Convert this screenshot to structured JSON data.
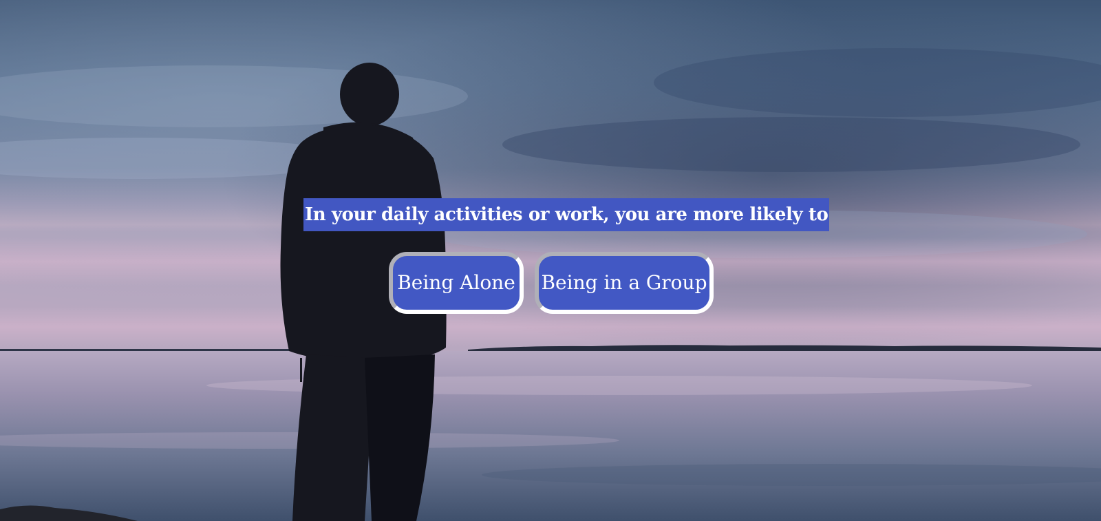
{
  "quiz": {
    "question": "In your daily activities or work, you are more likely to",
    "options": [
      {
        "label": "Being Alone"
      },
      {
        "label": "Being in a Group"
      }
    ]
  },
  "colors": {
    "accent": "#4257c2",
    "text": "#ffffff",
    "button_border_light": "#ffffff",
    "button_border_shade": "#b0b0b8"
  },
  "background": {
    "description_icon": "lake-silhouette-photo"
  }
}
